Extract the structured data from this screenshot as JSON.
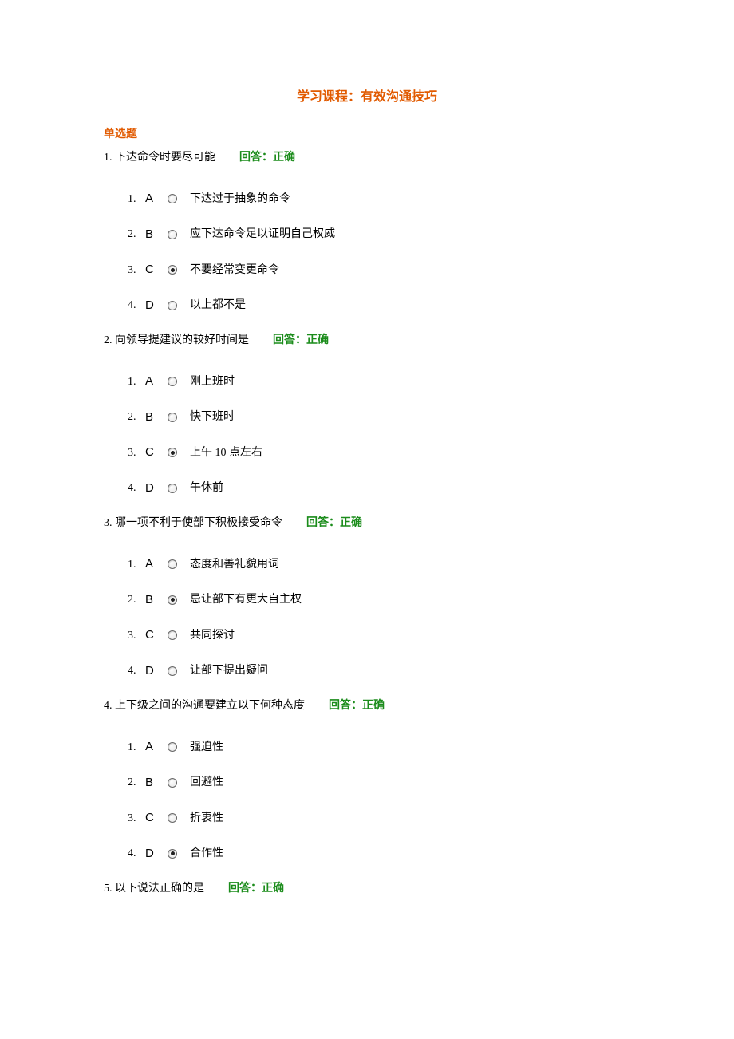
{
  "course_title": "学习课程：有效沟通技巧",
  "section_heading": "单选题",
  "feedback_label": "回答：正确",
  "questions": [
    {
      "num": "1.",
      "text": "下达命令时要尽可能",
      "options": [
        {
          "idx": "1.",
          "letter": "A",
          "text": "下达过于抽象的命令",
          "selected": false
        },
        {
          "idx": "2.",
          "letter": "B",
          "text": "应下达命令足以证明自己权威",
          "selected": false
        },
        {
          "idx": "3.",
          "letter": "C",
          "text": "不要经常变更命令",
          "selected": true
        },
        {
          "idx": "4.",
          "letter": "D",
          "text": "以上都不是",
          "selected": false
        }
      ]
    },
    {
      "num": "2.",
      "text": "向领导提建议的较好时间是",
      "options": [
        {
          "idx": "1.",
          "letter": "A",
          "text": "刚上班时",
          "selected": false
        },
        {
          "idx": "2.",
          "letter": "B",
          "text": "快下班时",
          "selected": false
        },
        {
          "idx": "3.",
          "letter": "C",
          "text": "上午 10 点左右",
          "selected": true
        },
        {
          "idx": "4.",
          "letter": "D",
          "text": "午休前",
          "selected": false
        }
      ]
    },
    {
      "num": "3.",
      "text": "哪一项不利于使部下积极接受命令",
      "options": [
        {
          "idx": "1.",
          "letter": "A",
          "text": "态度和善礼貌用词",
          "selected": false
        },
        {
          "idx": "2.",
          "letter": "B",
          "text": "忌让部下有更大自主权",
          "selected": true
        },
        {
          "idx": "3.",
          "letter": "C",
          "text": "共同探讨",
          "selected": false
        },
        {
          "idx": "4.",
          "letter": "D",
          "text": "让部下提出疑问",
          "selected": false
        }
      ]
    },
    {
      "num": "4.",
      "text": "上下级之间的沟通要建立以下何种态度",
      "options": [
        {
          "idx": "1.",
          "letter": "A",
          "text": "强迫性",
          "selected": false
        },
        {
          "idx": "2.",
          "letter": "B",
          "text": "回避性",
          "selected": false
        },
        {
          "idx": "3.",
          "letter": "C",
          "text": "折衷性",
          "selected": false
        },
        {
          "idx": "4.",
          "letter": "D",
          "text": "合作性",
          "selected": true
        }
      ]
    },
    {
      "num": "5.",
      "text": "以下说法正确的是",
      "options": []
    }
  ]
}
